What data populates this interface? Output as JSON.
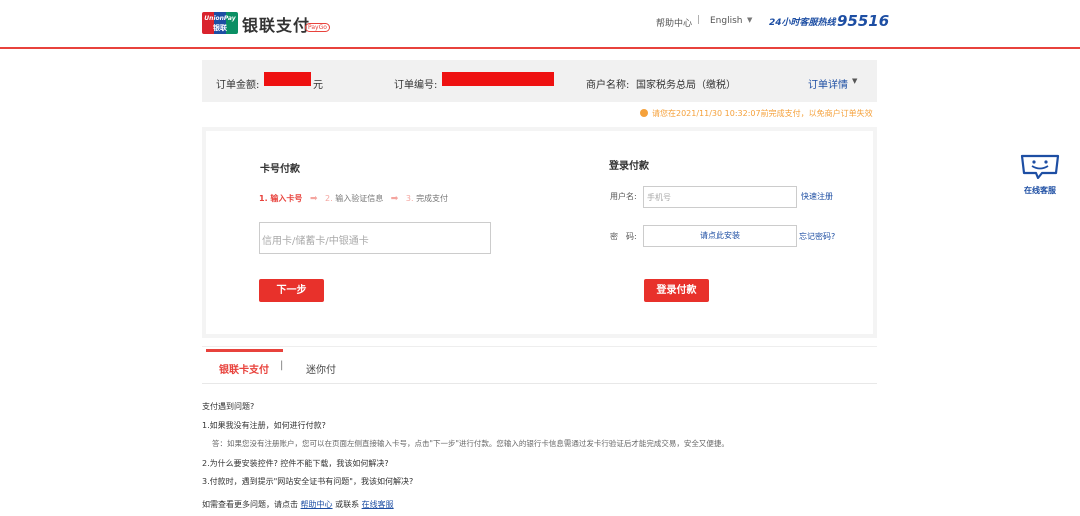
{
  "header": {
    "logo_text_top": "UnionPay",
    "logo_text_bottom": "银联",
    "brand": "银联支付",
    "brand_badge": "PayGo",
    "help_center": "帮助中心",
    "separator": "|",
    "language": "English",
    "hotline_label": "24小时客服热线",
    "hotline_number": "95516"
  },
  "order": {
    "amount_label": "订单金额:",
    "amount_unit": "元",
    "number_label": "订单编号:",
    "merchant_label": "商户名称:",
    "merchant_name": "国家税务总局（缴税）",
    "detail_link": "订单详情",
    "notice": "请您在2021/11/30 10:32:07前完成支付，以免商户订单失效"
  },
  "card_pay": {
    "title": "卡号付款",
    "steps": [
      {
        "num": "1.",
        "label": "输入卡号"
      },
      {
        "num": "2.",
        "label": "输入验证信息"
      },
      {
        "num": "3.",
        "label": "完成支付"
      }
    ],
    "card_placeholder": "信用卡/储蓄卡/中银通卡",
    "next_button": "下一步"
  },
  "login_pay": {
    "title": "登录付款",
    "username_label": "用户名:",
    "username_placeholder": "手机号",
    "quick_register": "快速注册",
    "password_label": "密　码:",
    "install_prompt": "请点此安装",
    "forgot_password": "忘记密码?",
    "login_button": "登录付款"
  },
  "tabs": {
    "tab1": "银联卡支付",
    "separator": "|",
    "tab2": "迷你付"
  },
  "faq": {
    "title": "支付遇到问题?",
    "q1": "1.如果我没有注册，如何进行付款?",
    "a1": "答：如果您没有注册账户，您可以在页面左侧直接输入卡号，点击\"下一步\"进行付款。您输入的银行卡信息需通过发卡行验证后才能完成交易，安全又便捷。",
    "q2": "2.为什么要安装控件? 控件不能下载，我该如何解决?",
    "q3": "3.付款时，遇到提示\"网站安全证书有问题\"，我该如何解决?",
    "more_prefix": "如需查看更多问题，请点击",
    "more_help": "帮助中心",
    "more_or": "或联系",
    "more_cs": "在线客服"
  },
  "online_service": {
    "label": "在线客服",
    "icon": "chat-face-icon"
  },
  "colors": {
    "accent": "#e8423c",
    "brand_blue": "#1d4ea3",
    "notice": "#f5a13b"
  }
}
